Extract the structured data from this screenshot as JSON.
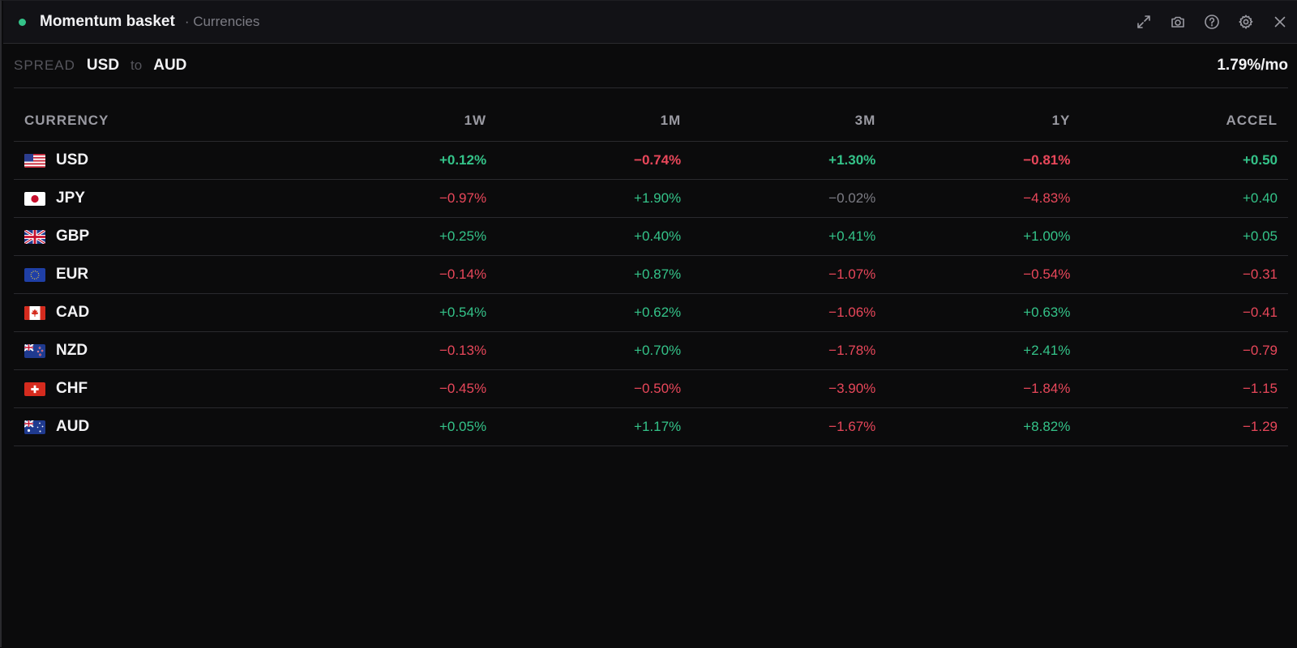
{
  "window": {
    "title": "Momentum basket",
    "subtitle": "· Currencies",
    "status_color": "#34c389",
    "controls": [
      "expand-icon",
      "camera-icon",
      "help-icon",
      "gear-icon",
      "close-icon"
    ]
  },
  "spread": {
    "label": "SPREAD",
    "from": "USD",
    "to_word": "to",
    "to": "AUD",
    "value": "1.79%/mo"
  },
  "table": {
    "columns": [
      "CURRENCY",
      "1W",
      "1M",
      "3M",
      "1Y",
      "ACCEL"
    ],
    "rows": [
      {
        "currency": "USD",
        "flag": "us-flag",
        "w1": "+0.12%",
        "m1": "−0.74%",
        "m3": "+1.30%",
        "y1": "−0.81%",
        "accel": "+0.50"
      },
      {
        "currency": "JPY",
        "flag": "jp-flag",
        "w1": "−0.97%",
        "m1": "+1.90%",
        "m3": "−0.02%",
        "y1": "−4.83%",
        "accel": "+0.40"
      },
      {
        "currency": "GBP",
        "flag": "gb-flag",
        "w1": "+0.25%",
        "m1": "+0.40%",
        "m3": "+0.41%",
        "y1": "+1.00%",
        "accel": "+0.05"
      },
      {
        "currency": "EUR",
        "flag": "eu-flag",
        "w1": "−0.14%",
        "m1": "+0.87%",
        "m3": "−1.07%",
        "y1": "−0.54%",
        "accel": "−0.31"
      },
      {
        "currency": "CAD",
        "flag": "ca-flag",
        "w1": "+0.54%",
        "m1": "+0.62%",
        "m3": "−1.06%",
        "y1": "+0.63%",
        "accel": "−0.41"
      },
      {
        "currency": "NZD",
        "flag": "nz-flag",
        "w1": "−0.13%",
        "m1": "+0.70%",
        "m3": "−1.78%",
        "y1": "+2.41%",
        "accel": "−0.79"
      },
      {
        "currency": "CHF",
        "flag": "ch-flag",
        "w1": "−0.45%",
        "m1": "−0.50%",
        "m3": "−3.90%",
        "y1": "−1.84%",
        "accel": "−1.15"
      },
      {
        "currency": "AUD",
        "flag": "au-flag",
        "w1": "+0.05%",
        "m1": "+1.17%",
        "m3": "−1.67%",
        "y1": "+8.82%",
        "accel": "−1.29"
      }
    ]
  },
  "colors": {
    "positive": "#34c389",
    "negative": "#e8475a",
    "neutral": "#7c7c84"
  }
}
